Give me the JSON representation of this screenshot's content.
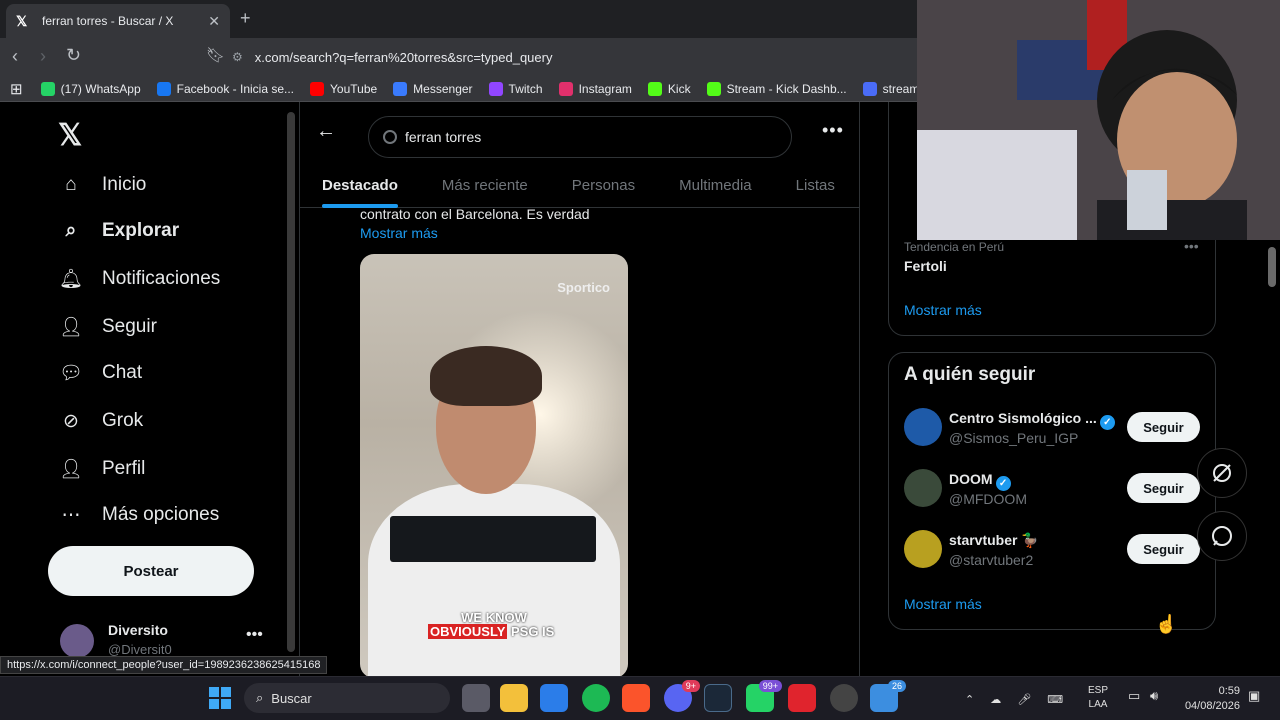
{
  "browser": {
    "tab_title": "ferran torres - Buscar / X",
    "url": "x.com/search?q=ferran%20torres&src=typed_query",
    "bookmarks": [
      {
        "label": "(17) WhatsApp",
        "color": "#25d366"
      },
      {
        "label": "Facebook - Inicia se...",
        "color": "#1877f2"
      },
      {
        "label": "YouTube",
        "color": "#ff0000"
      },
      {
        "label": "Messenger",
        "color": "#3a7bfd"
      },
      {
        "label": "Twitch",
        "color": "#9146ff"
      },
      {
        "label": "Instagram",
        "color": "#e1306c"
      },
      {
        "label": "Kick",
        "color": "#53fc18"
      },
      {
        "label": "Stream - Kick Dashb...",
        "color": "#53fc18"
      },
      {
        "label": "stream tiktok",
        "color": "#4a6cf7"
      }
    ],
    "status_url": "https://x.com/i/connect_people?user_id=1989236238625415168"
  },
  "nav": {
    "logo": "𝕏",
    "items": [
      {
        "label": "Inicio",
        "icon": "home-icon"
      },
      {
        "label": "Explorar",
        "icon": "search-icon"
      },
      {
        "label": "Notificaciones",
        "icon": "bell-icon"
      },
      {
        "label": "Seguir",
        "icon": "add-person-icon"
      },
      {
        "label": "Chat",
        "icon": "chat-icon"
      },
      {
        "label": "Grok",
        "icon": "grok-icon"
      },
      {
        "label": "Perfil",
        "icon": "person-icon"
      },
      {
        "label": "Más opciones",
        "icon": "more-circle-icon"
      }
    ],
    "post_label": "Postear",
    "profile": {
      "name": "Diversito",
      "handle": "@Diversit0"
    }
  },
  "search": {
    "query": "ferran torres",
    "tabs": [
      "Destacado",
      "Más reciente",
      "Personas",
      "Multimedia",
      "Listas"
    ],
    "active_tab": "Destacado"
  },
  "tweet": {
    "text": "contrato con el Barcelona. Es verdad",
    "show_more": "Mostrar más",
    "video": {
      "brand": "Sportico",
      "caption_line1": "WE KNOW",
      "caption_red": "OBVIOUSLY",
      "caption_white": " PSG IS"
    }
  },
  "trends": {
    "meta": "Tendencia en Perú",
    "name": "Fertoli",
    "show_more": "Mostrar más"
  },
  "who_to_follow": {
    "title": "A quién seguir",
    "accounts": [
      {
        "name": "Centro Sismológico ...",
        "handle": "@Sismos_Peru_IGP",
        "verified": true,
        "button": "Seguir",
        "color": "#1e5aa8"
      },
      {
        "name": "DOOM",
        "handle": "@MFDOOM",
        "verified": true,
        "button": "Seguir",
        "color": "#3a4a3a"
      },
      {
        "name": "starvtuber 🦆",
        "handle": "@starvtuber2",
        "verified": false,
        "button": "Seguir",
        "color": "#b8a020"
      }
    ],
    "show_more": "Mostrar más"
  },
  "taskbar": {
    "search_placeholder": "Buscar",
    "lang_line1": "ESP",
    "lang_line2": "LAA",
    "time": "0:59",
    "date": "04/08/2026",
    "badges": {
      "discord": "9+",
      "whatsapp": "99+",
      "calendar": "26"
    }
  }
}
